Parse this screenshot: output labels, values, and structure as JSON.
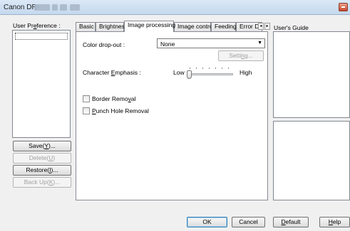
{
  "window": {
    "title": "Canon DR-"
  },
  "user_preference": {
    "label_prefix": "User Pr",
    "label_accel": "e",
    "label_suffix": "ference :"
  },
  "left_buttons": {
    "save": {
      "prefix": "Save(",
      "accel": "Y",
      "suffix": ")..."
    },
    "delete": {
      "prefix": "Delete(",
      "accel": "U",
      "suffix": ")"
    },
    "restore": {
      "prefix": "Restore(",
      "accel": "I",
      "suffix": ")..."
    },
    "backup": {
      "prefix": "Back Up(",
      "accel": "K",
      "suffix": ")..."
    }
  },
  "tabs": [
    {
      "label": "Basic"
    },
    {
      "label": "Brightness"
    },
    {
      "label": "Image processing"
    },
    {
      "label": "Image control"
    },
    {
      "label": "Feeding"
    },
    {
      "label": "Error De"
    }
  ],
  "image_processing": {
    "color_dropout_label": "Color drop-out :",
    "color_dropout_value": "None",
    "setting_prefix": "Setti",
    "setting_accel": "n",
    "setting_suffix": "g...",
    "char_emphasis_prefix": "Character ",
    "char_emphasis_accel": "E",
    "char_emphasis_suffix": "mphasis :",
    "slider_low": "Low",
    "slider_high": "High",
    "slider_position": 0,
    "border_removal_prefix": "Border Remo",
    "border_removal_accel": "v",
    "border_removal_suffix": "al",
    "border_removal_checked": false,
    "punch_hole_accel": "P",
    "punch_hole_suffix": "unch Hole Removal",
    "punch_hole_checked": false
  },
  "users_guide": {
    "title": "User's Guide"
  },
  "bottom_buttons": {
    "ok": "OK",
    "cancel": "Cancel",
    "default_accel": "D",
    "default_suffix": "efault",
    "help_accel": "H",
    "help_suffix": "elp"
  }
}
